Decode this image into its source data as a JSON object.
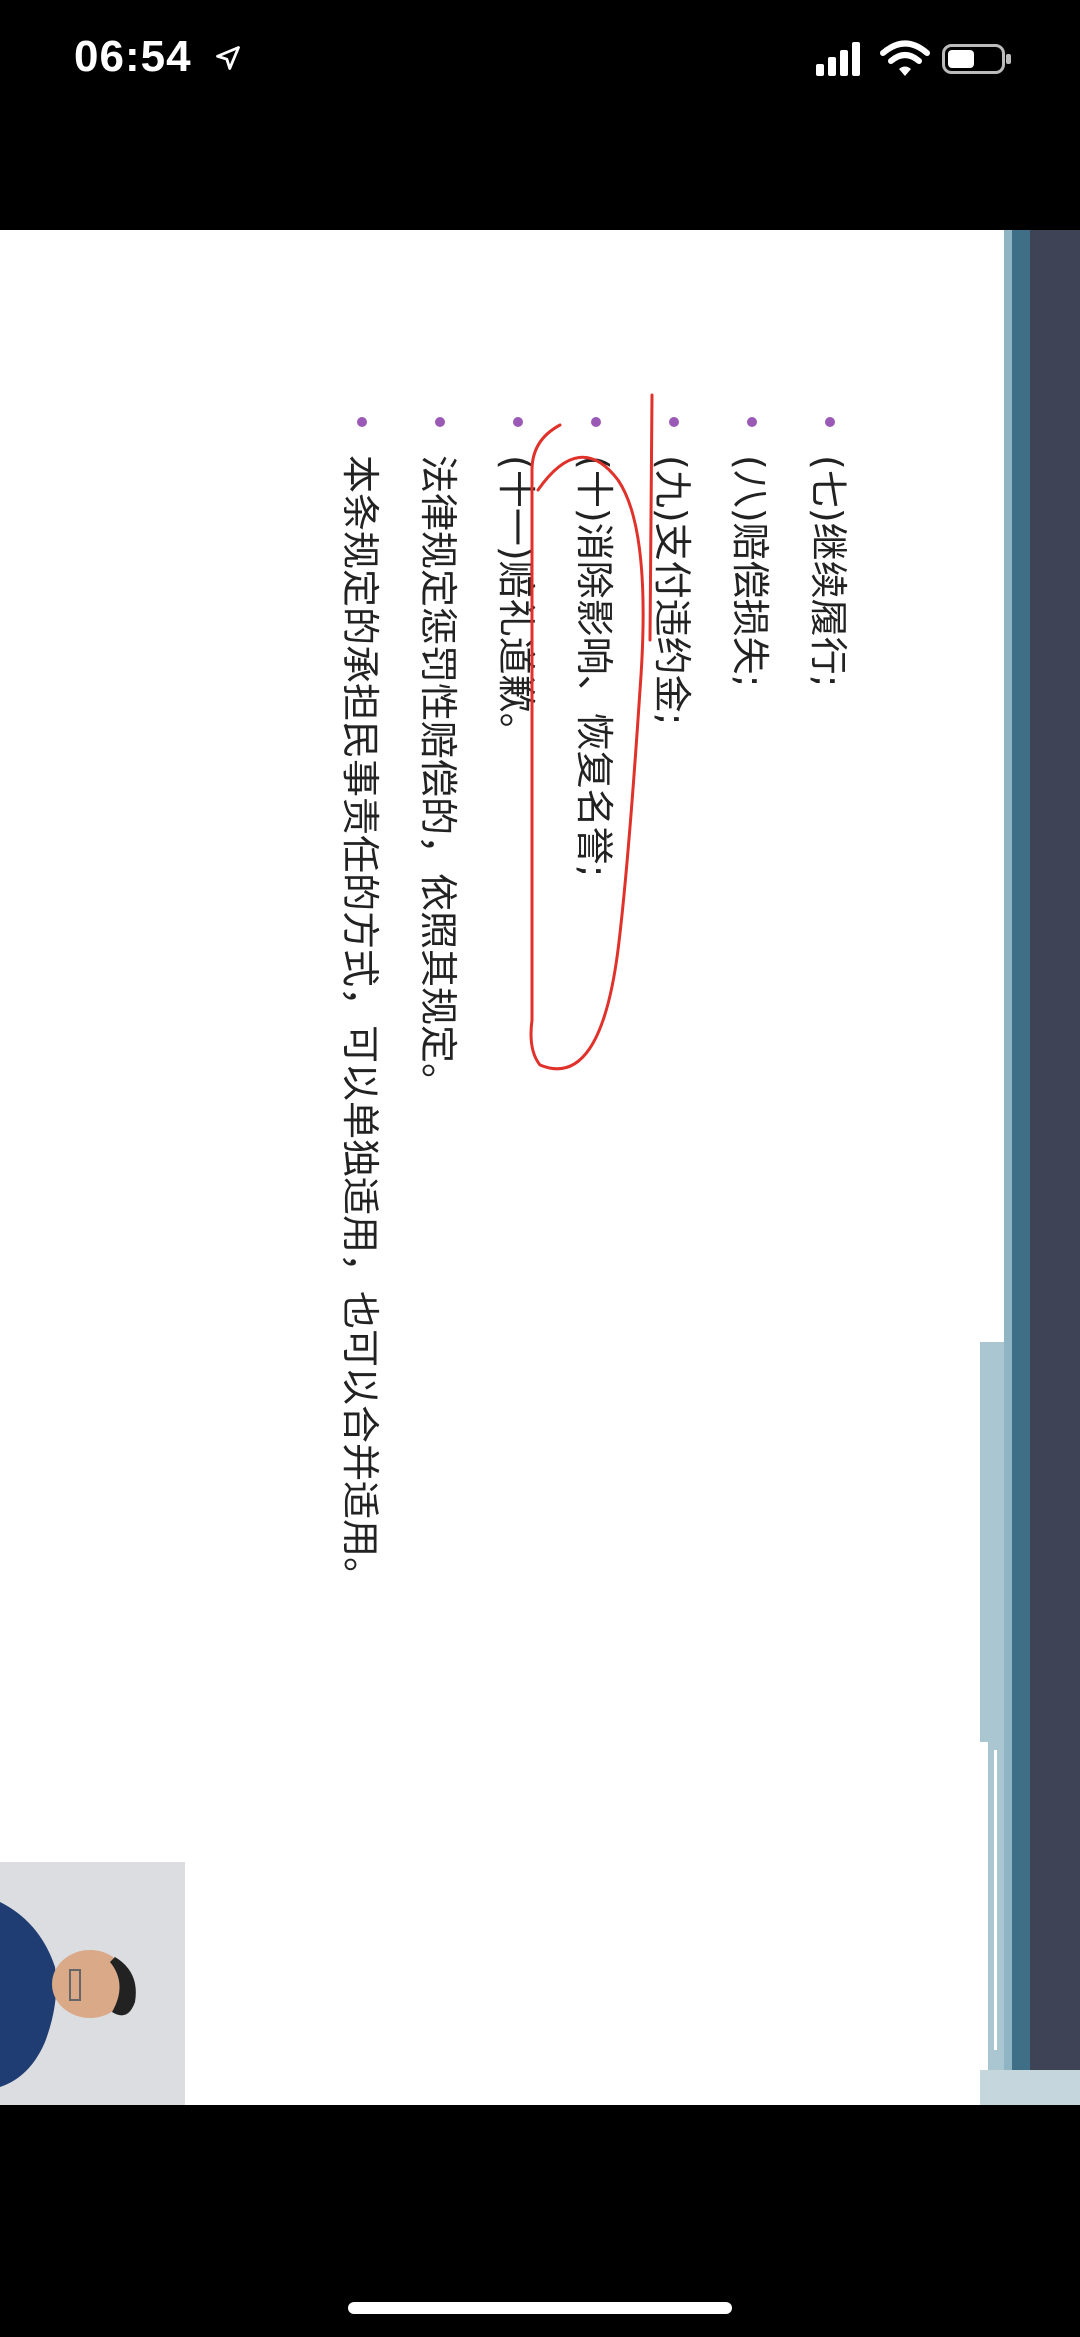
{
  "status_bar": {
    "time": "06:54"
  },
  "slide": {
    "items": [
      "(七)继续履行;",
      "(八)赔偿损失;",
      "(九)支付违约金;",
      "(十)消除影响、恢复名誉;",
      "(十一)赔礼道歉。",
      "法律规定惩罚性赔偿的，依照其规定。",
      "本条规定的承担民事责任的方式，可以单独适用，也可以合并适用。"
    ]
  },
  "colors": {
    "bullet": "#9b59b6",
    "annotation": "#e0322b",
    "band_dark": "#3f4356",
    "band_teal": "#3e6f86"
  }
}
